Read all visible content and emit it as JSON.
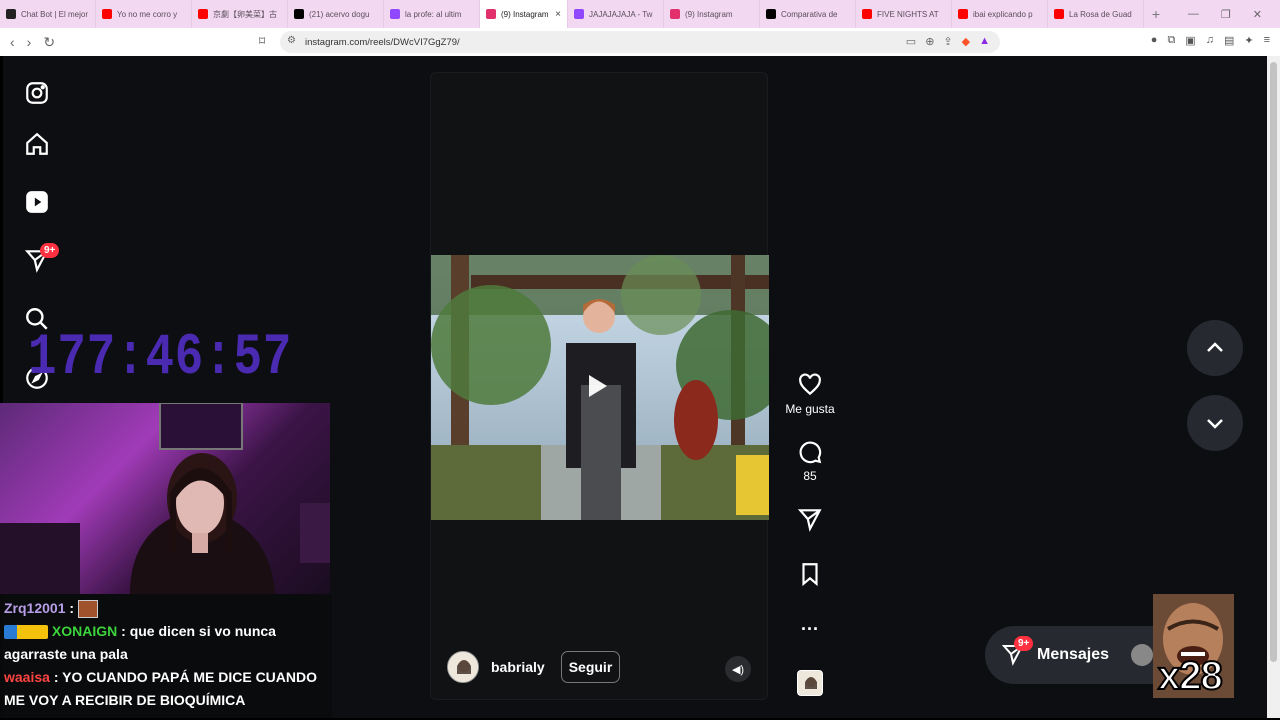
{
  "tabs": [
    {
      "title": "Chat Bot | El mejor",
      "color": "#222222"
    },
    {
      "title": "Yo no me corro y",
      "color": "#ff0000"
    },
    {
      "title": "京劇【卵美菜】古",
      "color": "#ff0000"
    },
    {
      "title": "(21) acervo dogu",
      "color": "#000000"
    },
    {
      "title": "la profe: al ultim",
      "color": "#9146ff"
    },
    {
      "title": "(9) Instagram",
      "color": "#e1306c",
      "active": true
    },
    {
      "title": "JAJAJAJAJA - Tw",
      "color": "#9146ff"
    },
    {
      "title": "(9) Instagram",
      "color": "#e1306c"
    },
    {
      "title": "Comparativa de",
      "color": "#000000"
    },
    {
      "title": "FIVE NIGHTS AT",
      "color": "#ff0000"
    },
    {
      "title": "ibai explicando p",
      "color": "#ff0000"
    },
    {
      "title": "La Rosa de Guad",
      "color": "#ff0000"
    }
  ],
  "browser": {
    "url": "instagram.com/reels/DWcVI7GgZ79/",
    "new_tab": "+",
    "close_tab": "×"
  },
  "sidebar": {
    "notifications_badge": "9+"
  },
  "overlay": {
    "timer": "177:46:57",
    "multiplier": "x28"
  },
  "reel": {
    "username": "babrialy",
    "follow_label": "Seguir",
    "like_label": "Me gusta",
    "comments_count": "85",
    "more_label": "..."
  },
  "messages": {
    "label": "Mensajes",
    "badge": "9+"
  },
  "chat": [
    {
      "user": "Zrq12001",
      "user_color": "#b79fe8",
      "text": ""
    },
    {
      "user": "XONAIGN",
      "user_color": "#3cd43c",
      "text": "que dicen si vo nunca agarraste una pala"
    },
    {
      "user": "waaisa",
      "user_color": "#ff4444",
      "text": "YO CUANDO PAPÁ ME DICE CUANDO ME VOY A RECIBIR DE BIOQUÍMICA"
    }
  ],
  "colors": {
    "page_bg": "#0c0e11",
    "tabbar_bg": "#f3d8f2",
    "timer": "#4a2ab0",
    "badge": "#ff3040"
  }
}
